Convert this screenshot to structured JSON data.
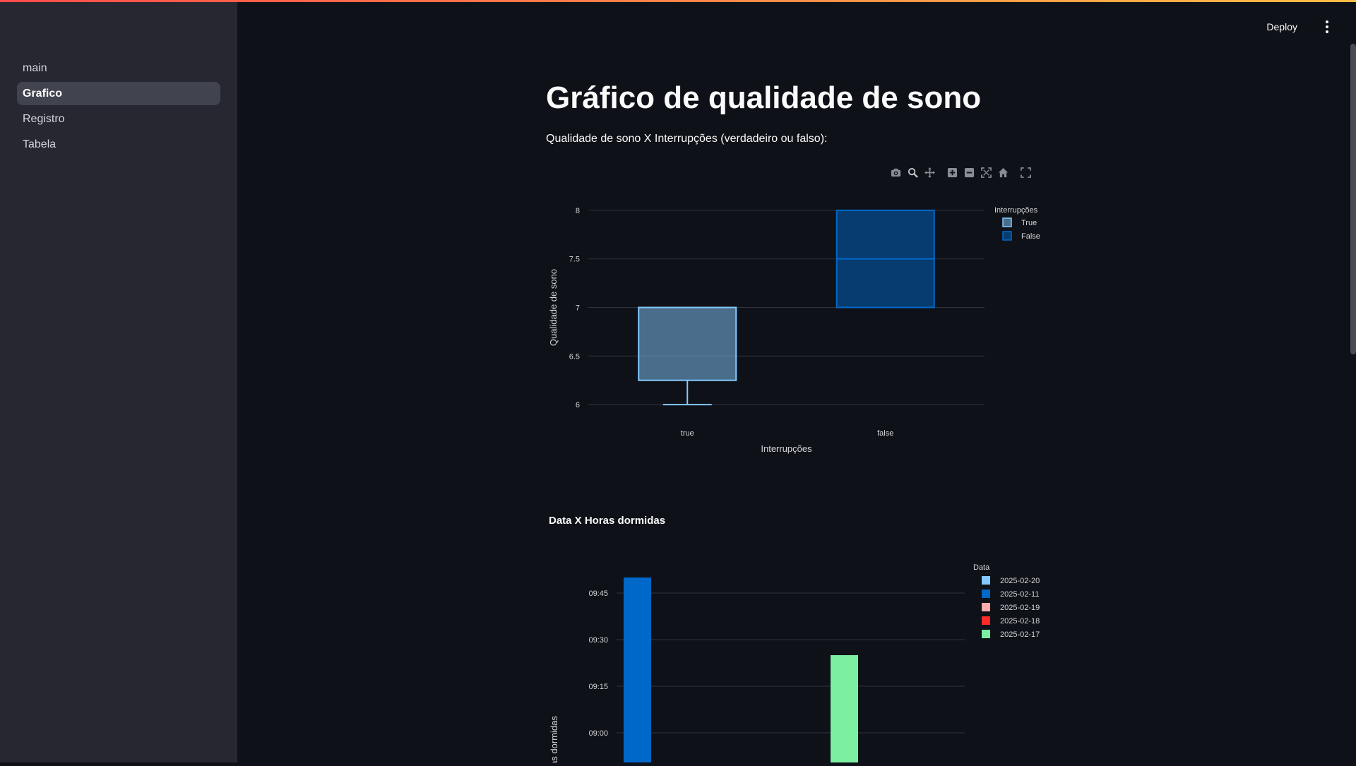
{
  "sidebar": {
    "items": [
      {
        "label": "main",
        "active": false
      },
      {
        "label": "Grafico",
        "active": true
      },
      {
        "label": "Registro",
        "active": false
      },
      {
        "label": "Tabela",
        "active": false
      }
    ]
  },
  "header": {
    "deploy_label": "Deploy",
    "menu_icon": "more-vertical-icon"
  },
  "page": {
    "title": "Gráfico de qualidade de sono",
    "subtitle": "Qualidade de sono X Interrupções (verdadeiro ou falso):"
  },
  "modebar": {
    "icons": [
      "camera-icon",
      "zoom-icon",
      "pan-icon",
      "zoom-in-icon",
      "zoom-out-icon",
      "autoscale-icon",
      "home-icon",
      "fullscreen-icon"
    ]
  },
  "colors": {
    "accent": "#ff4b4b",
    "true_box": "#83c9ff",
    "false_box": "#0068c9",
    "d20": "#83c9ff",
    "d11": "#0068c9",
    "d19": "#ffabab",
    "d18": "#ff2b2b",
    "d17": "#7defa1"
  },
  "chart_data": [
    {
      "type": "box",
      "xlabel": "Interrupções",
      "ylabel": "Qualidade de sono",
      "categories": [
        "true",
        "false"
      ],
      "yticks": [
        "6",
        "6.5",
        "7",
        "7.5",
        "8"
      ],
      "ylim": [
        5.95,
        8.05
      ],
      "legend_title": "Interrupções",
      "series": [
        {
          "name": "True",
          "category": "true",
          "min": 6,
          "q1": 6.25,
          "median": 7,
          "q3": 7,
          "max": 7,
          "color": "#83c9ff"
        },
        {
          "name": "False",
          "category": "false",
          "min": 7,
          "q1": 7,
          "median": 7.5,
          "q3": 8,
          "max": 8,
          "color": "#0068c9"
        }
      ],
      "grid": true,
      "legend_position": "top-right"
    },
    {
      "type": "bar",
      "title": "Data X Horas dormidas",
      "ylabel": "Horas dormidas",
      "yticks": [
        "09:00",
        "09:15",
        "09:30",
        "09:45"
      ],
      "legend_title": "Data",
      "series": [
        {
          "name": "2025-02-20",
          "color": "#83c9ff"
        },
        {
          "name": "2025-02-11",
          "value_minutes": 590,
          "color": "#0068c9"
        },
        {
          "name": "2025-02-19",
          "color": "#ffabab"
        },
        {
          "name": "2025-02-18",
          "color": "#ff2b2b"
        },
        {
          "name": "2025-02-17",
          "value_minutes": 565,
          "color": "#7defa1"
        }
      ],
      "grid": true,
      "legend_position": "top-right"
    }
  ]
}
